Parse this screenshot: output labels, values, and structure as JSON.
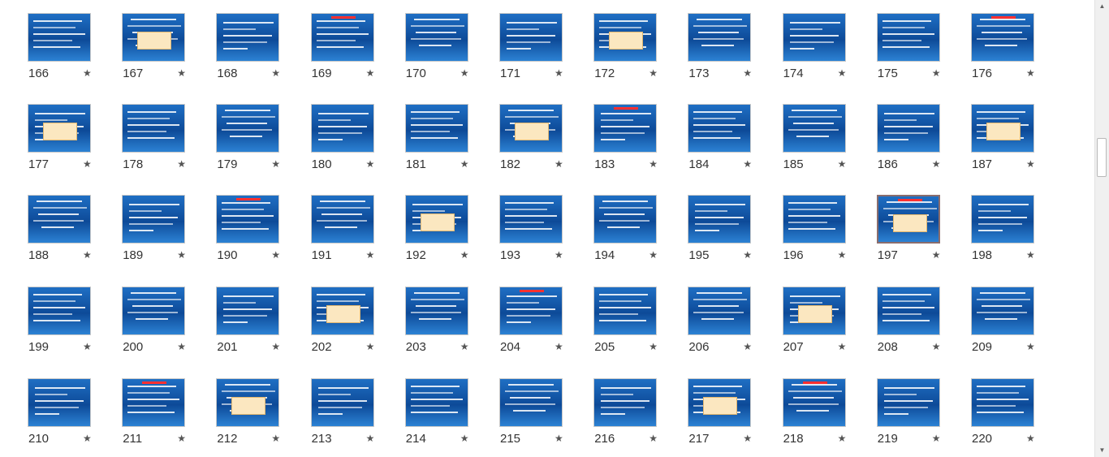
{
  "slides": [
    {
      "number": "166",
      "star": "★"
    },
    {
      "number": "167",
      "star": "★"
    },
    {
      "number": "168",
      "star": "★"
    },
    {
      "number": "169",
      "star": "★"
    },
    {
      "number": "170",
      "star": "★"
    },
    {
      "number": "171",
      "star": "★"
    },
    {
      "number": "172",
      "star": "★"
    },
    {
      "number": "173",
      "star": "★"
    },
    {
      "number": "174",
      "star": "★"
    },
    {
      "number": "175",
      "star": "★"
    },
    {
      "number": "176",
      "star": "★"
    },
    {
      "number": "177",
      "star": "★"
    },
    {
      "number": "178",
      "star": "★"
    },
    {
      "number": "179",
      "star": "★"
    },
    {
      "number": "180",
      "star": "★"
    },
    {
      "number": "181",
      "star": "★"
    },
    {
      "number": "182",
      "star": "★"
    },
    {
      "number": "183",
      "star": "★"
    },
    {
      "number": "184",
      "star": "★"
    },
    {
      "number": "185",
      "star": "★"
    },
    {
      "number": "186",
      "star": "★"
    },
    {
      "number": "187",
      "star": "★"
    },
    {
      "number": "188",
      "star": "★"
    },
    {
      "number": "189",
      "star": "★"
    },
    {
      "number": "190",
      "star": "★"
    },
    {
      "number": "191",
      "star": "★"
    },
    {
      "number": "192",
      "star": "★"
    },
    {
      "number": "193",
      "star": "★"
    },
    {
      "number": "194",
      "star": "★"
    },
    {
      "number": "195",
      "star": "★"
    },
    {
      "number": "196",
      "star": "★"
    },
    {
      "number": "197",
      "star": "★",
      "selected": true
    },
    {
      "number": "198",
      "star": "★"
    },
    {
      "number": "199",
      "star": "★"
    },
    {
      "number": "200",
      "star": "★"
    },
    {
      "number": "201",
      "star": "★"
    },
    {
      "number": "202",
      "star": "★"
    },
    {
      "number": "203",
      "star": "★"
    },
    {
      "number": "204",
      "star": "★"
    },
    {
      "number": "205",
      "star": "★"
    },
    {
      "number": "206",
      "star": "★"
    },
    {
      "number": "207",
      "star": "★"
    },
    {
      "number": "208",
      "star": "★"
    },
    {
      "number": "209",
      "star": "★"
    },
    {
      "number": "210",
      "star": "★"
    },
    {
      "number": "211",
      "star": "★"
    },
    {
      "number": "212",
      "star": "★"
    },
    {
      "number": "213",
      "star": "★"
    },
    {
      "number": "214",
      "star": "★"
    },
    {
      "number": "215",
      "star": "★"
    },
    {
      "number": "216",
      "star": "★"
    },
    {
      "number": "217",
      "star": "★"
    },
    {
      "number": "218",
      "star": "★"
    },
    {
      "number": "219",
      "star": "★"
    },
    {
      "number": "220",
      "star": "★"
    }
  ],
  "scrollbar": {
    "up_arrow": "▲",
    "down_arrow": "▼"
  },
  "colors": {
    "slide_bg": "#0d4a98",
    "selected_border": "#8a6d6d",
    "text": "#333333"
  }
}
